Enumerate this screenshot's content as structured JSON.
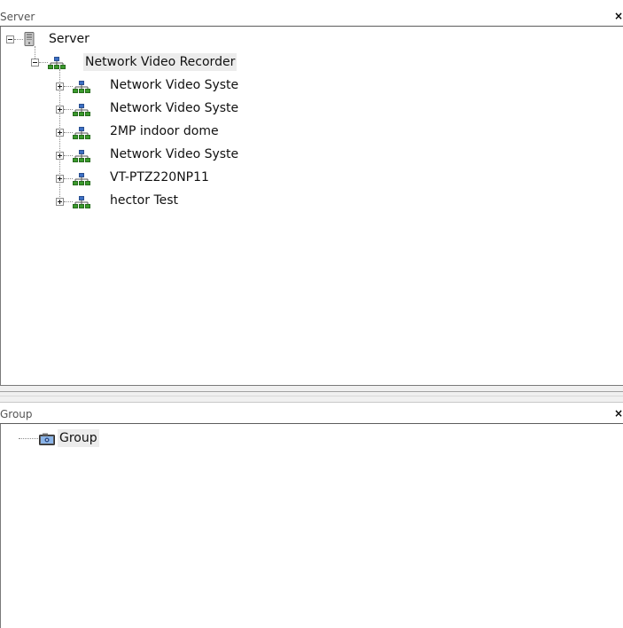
{
  "server_panel": {
    "title": "Server",
    "close_glyph": "×",
    "tree": {
      "root": {
        "label": "Server",
        "icon": "server-icon",
        "expanded": true
      },
      "recorder": {
        "label": "Network Video Recorder",
        "icon": "network-icon",
        "expanded": true
      },
      "devices": [
        {
          "label": "Network Video Syste",
          "icon": "network-icon",
          "expanded": false
        },
        {
          "label": "Network Video Syste",
          "icon": "network-icon",
          "expanded": false
        },
        {
          "label": "2MP indoor dome",
          "icon": "network-icon",
          "expanded": false
        },
        {
          "label": "Network Video Syste",
          "icon": "network-icon",
          "expanded": false
        },
        {
          "label": "VT-PTZ220NP11",
          "icon": "network-icon",
          "expanded": false
        },
        {
          "label": "hector Test",
          "icon": "network-icon",
          "expanded": false
        }
      ]
    }
  },
  "group_panel": {
    "title": "Group",
    "close_glyph": "×",
    "tree": {
      "root": {
        "label": "Group",
        "icon": "camera-group-icon"
      }
    }
  },
  "colors": {
    "network_icon_green": "#3a9a2c",
    "network_icon_blue": "#3c6fc4",
    "selection": "#ececec"
  }
}
